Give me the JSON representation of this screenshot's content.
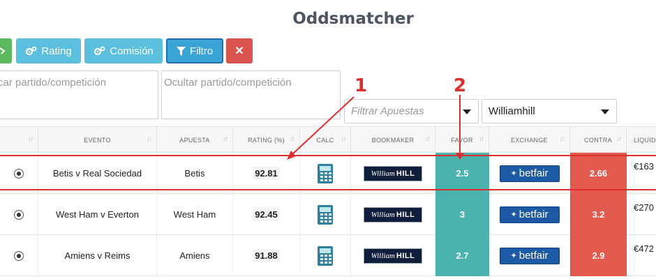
{
  "title": "Oddsmatcher",
  "toolbar": {
    "rating_label": "Rating",
    "comision_label": "Comisión",
    "filtro_label": "Filtro",
    "close_label": "✕"
  },
  "filters": {
    "buscar_placeholder": "car partido/competición",
    "ocultar_placeholder": "Ocultar partido/competición",
    "apuestas_placeholder": "Filtrar Apuestas",
    "bookmaker_selected": "Williamhill"
  },
  "table": {
    "headers": {
      "evento": "EVENTO",
      "apuesta": "APUESTA",
      "rating": "RATING (%)",
      "calc": "CALC",
      "bookmaker": "BOOKMAKER",
      "favor": "FAVOR",
      "exchange": "EXCHANGE",
      "contra": "CONTRA",
      "liquidez": "LIQUID"
    },
    "rows": [
      {
        "evento": "Betis v Real Sociedad",
        "apuesta": "Betis",
        "rating": "92.81",
        "favor": "2.5",
        "contra": "2.66",
        "liquidez": "€163"
      },
      {
        "evento": "West Ham v Everton",
        "apuesta": "West Ham",
        "rating": "92.45",
        "favor": "3",
        "contra": "3.2",
        "liquidez": "€270"
      },
      {
        "evento": "Amiens v Reims",
        "apuesta": "Amiens",
        "rating": "91.88",
        "favor": "2.7",
        "contra": "2.9",
        "liquidez": "€472"
      }
    ],
    "bookmaker_logo": {
      "script": "William",
      "bold": "HILL"
    },
    "exchange_logo": "betfair"
  },
  "annotations": {
    "label_1": "1",
    "label_2": "2",
    "color": "#e02d2d"
  },
  "colors": {
    "favor": "#4ab3ad",
    "contra": "#e35a4f",
    "info_button": "#5bc0de",
    "close_button": "#d9534f",
    "green_button": "#5cb85c"
  }
}
